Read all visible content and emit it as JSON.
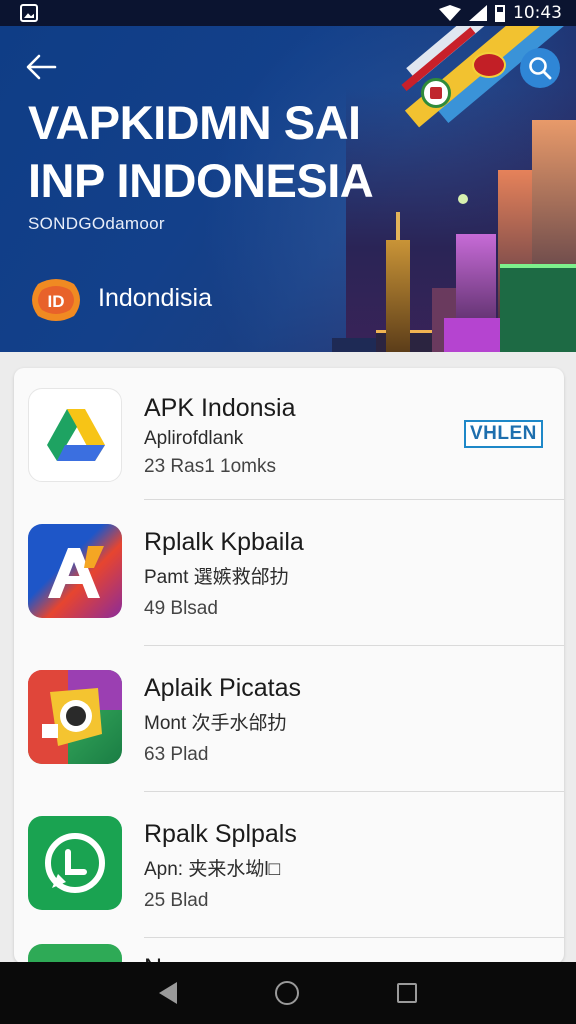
{
  "status_bar": {
    "time": "10:43"
  },
  "hero": {
    "title_line1": "VAPKIDMN SAI",
    "title_line2": "INP INDONESIA",
    "subtitle": "SONDGOdamoor",
    "logo_text": "ID",
    "brand": "Indondisia",
    "colors": {
      "background": "#13408a",
      "accent": "#f2c230",
      "search": "#2f86d6"
    }
  },
  "apps": [
    {
      "name": "APK Indonsia",
      "description": "Aplirofdlank",
      "meta": "23 Ras1 1omks",
      "action": "VHLEN",
      "icon": "google-drive-icon"
    },
    {
      "name": "Rplalk Kpbaila",
      "description": "Pamt 選嫉救邰扐",
      "meta": "49 Blsad",
      "icon": "letter-a-icon"
    },
    {
      "name": "Aplaik Picatas",
      "description": "Mont 次手水邰扐",
      "meta": "63 Plad",
      "icon": "camera-lens-icon"
    },
    {
      "name": "Rpalk Splpals",
      "description": "Apn: 夹来水坳l□",
      "meta": "25 Blad",
      "icon": "whatsapp-style-icon"
    },
    {
      "name": "N",
      "description": "",
      "meta": "",
      "icon": "green-app-icon"
    }
  ],
  "nav": {
    "icons": [
      "back-triangle-icon",
      "home-circle-icon",
      "recents-square-icon"
    ]
  }
}
